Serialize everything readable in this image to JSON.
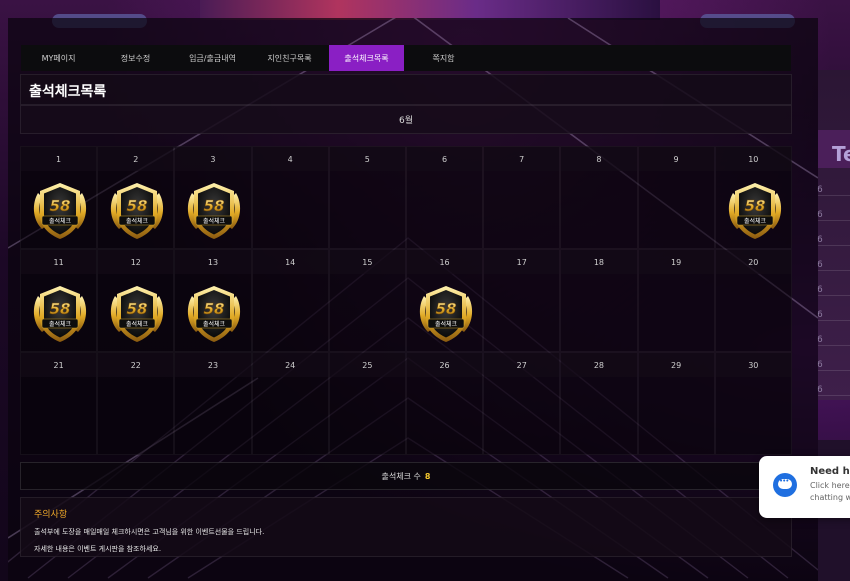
{
  "tabs": [
    {
      "label": "MY페이지",
      "active": false
    },
    {
      "label": "정보수정",
      "active": false
    },
    {
      "label": "입금/출금내역",
      "active": false
    },
    {
      "label": "지인친구목록",
      "active": false
    },
    {
      "label": "출석체크목록",
      "active": true
    },
    {
      "label": "쪽지함",
      "active": false
    }
  ],
  "page_title": "출석체크목록",
  "month_label": "6월",
  "calendar": {
    "days": [
      {
        "n": "1",
        "checked": true
      },
      {
        "n": "2",
        "checked": true
      },
      {
        "n": "3",
        "checked": true
      },
      {
        "n": "4",
        "checked": false
      },
      {
        "n": "5",
        "checked": false
      },
      {
        "n": "6",
        "checked": false
      },
      {
        "n": "7",
        "checked": false
      },
      {
        "n": "8",
        "checked": false
      },
      {
        "n": "9",
        "checked": false
      },
      {
        "n": "10",
        "checked": true
      },
      {
        "n": "11",
        "checked": true
      },
      {
        "n": "12",
        "checked": true
      },
      {
        "n": "13",
        "checked": true
      },
      {
        "n": "14",
        "checked": false
      },
      {
        "n": "15",
        "checked": false
      },
      {
        "n": "16",
        "checked": true
      },
      {
        "n": "17",
        "checked": false
      },
      {
        "n": "18",
        "checked": false
      },
      {
        "n": "19",
        "checked": false
      },
      {
        "n": "20",
        "checked": false
      },
      {
        "n": "21",
        "checked": false
      },
      {
        "n": "22",
        "checked": false
      },
      {
        "n": "23",
        "checked": false
      },
      {
        "n": "24",
        "checked": false
      },
      {
        "n": "25",
        "checked": false
      },
      {
        "n": "26",
        "checked": false
      },
      {
        "n": "27",
        "checked": false
      },
      {
        "n": "28",
        "checked": false
      },
      {
        "n": "29",
        "checked": false
      },
      {
        "n": "30",
        "checked": false
      }
    ],
    "stamp_logo": "58",
    "stamp_text": "출석체크"
  },
  "count": {
    "label": "출석체크 수",
    "value": "8"
  },
  "notice": {
    "title": "주의사항",
    "lines": [
      "출석부에 도장을 매일매일 체크하시면은 고객님을 위한 이벤트선물을 드립니다.",
      "자세한 내용은 이벤트 게시판을 참조하세요."
    ]
  },
  "chat": {
    "title": "Need he",
    "line1": "Click here",
    "line2": "chatting w"
  },
  "background": {
    "right_panel_letter": "Te",
    "right_panel_numbers": [
      "6",
      "6",
      "6",
      "6",
      "6",
      "6",
      "6",
      "6",
      "6"
    ]
  },
  "colors": {
    "accent": "#8a1fc4",
    "count_value": "#f3c62d",
    "notice_title": "#f0a92a",
    "chat_icon": "#1f6fe0"
  }
}
